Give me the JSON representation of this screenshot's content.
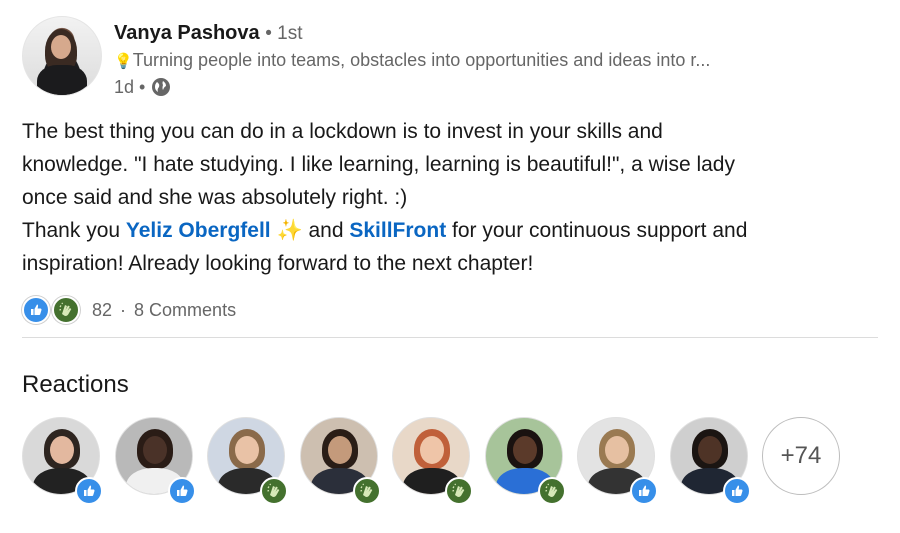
{
  "post": {
    "author_name": "Vanya Pashova",
    "degree": "• 1st",
    "headline": "Turning people into teams, obstacles into opportunities and ideas into r...",
    "time": "1d •",
    "text_line1": "The best thing you can do in a lockdown is to invest in your skills and",
    "text_line2": "knowledge. \"I hate studying. I like learning, learning is beautiful!\", a wise lady",
    "text_line3": "once said and she was absolutely right. :)",
    "text_line4_prefix": "Thank you ",
    "mention1": "Yeliz Obergfell",
    "sparkle": "✨",
    "text_line4_mid": " and ",
    "mention2": "SkillFront",
    "text_line4_suffix": " for your continuous support and",
    "text_line5": "inspiration! Already looking forward to the next chapter!"
  },
  "social": {
    "reaction_count": "82",
    "separator": "·",
    "comments": "8 Comments"
  },
  "reactions": {
    "title": "Reactions",
    "more_label": "+74",
    "people": [
      {
        "reaction": "like",
        "skin": "#e3b89f",
        "hair": "#2e2520",
        "body": "#222222",
        "bg": "#d9d9d9"
      },
      {
        "reaction": "like",
        "skin": "#4a3228",
        "hair": "#2a1c16",
        "body": "#f0f0f0",
        "bg": "#b9b9b9"
      },
      {
        "reaction": "clap",
        "skin": "#e9c2a6",
        "hair": "#8a6a4a",
        "body": "#2a2a2a",
        "bg": "#cfd7e3"
      },
      {
        "reaction": "clap",
        "skin": "#c49a7b",
        "hair": "#2a1d16",
        "body": "#2b2f3a",
        "bg": "#cdbfb0"
      },
      {
        "reaction": "clap",
        "skin": "#efc5a8",
        "hair": "#c0603a",
        "body": "#1f1f1f",
        "bg": "#e8d8c8"
      },
      {
        "reaction": "clap",
        "skin": "#5b3a2a",
        "hair": "#1a1210",
        "body": "#2a6fd6",
        "bg": "#a7c49a"
      },
      {
        "reaction": "like",
        "skin": "#e6c0a2",
        "hair": "#9a7a52",
        "body": "#333333",
        "bg": "#e3e3e3"
      },
      {
        "reaction": "like",
        "skin": "#4e3326",
        "hair": "#1b1512",
        "body": "#1f2633",
        "bg": "#cfcfcf"
      }
    ]
  },
  "colors": {
    "link": "#0a66c2",
    "like": "#378fe9",
    "clap": "#44712e"
  },
  "icons": {
    "bulb": "lightbulb-icon",
    "visibility": "globe-icon",
    "like": "like-reaction-icon",
    "clap": "celebrate-reaction-icon"
  }
}
